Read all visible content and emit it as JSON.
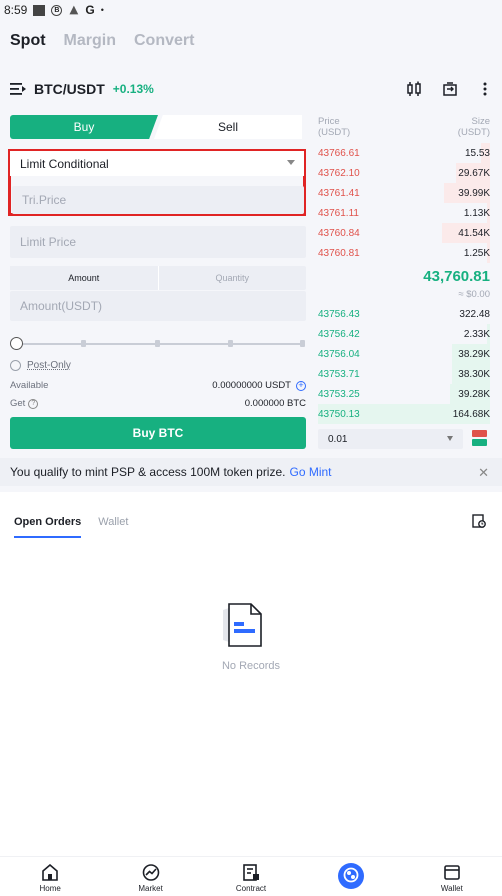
{
  "status_bar": {
    "time": "8:59"
  },
  "mode_tabs": [
    {
      "label": "Spot",
      "active": true
    },
    {
      "label": "Margin",
      "active": false
    },
    {
      "label": "Convert",
      "active": false
    }
  ],
  "pair": {
    "symbol": "BTC/USDT",
    "change": "+0.13%"
  },
  "order_form": {
    "buy_label": "Buy",
    "sell_label": "Sell",
    "order_type": "Limit Conditional",
    "trigger_price_placeholder": "Tri.Price",
    "limit_price_placeholder": "Limit Price",
    "amount_tab": "Amount",
    "quantity_tab": "Quantity",
    "amount_placeholder": "Amount(USDT)",
    "slider_percent": 0,
    "post_only_label": "Post-Only",
    "available_label": "Available",
    "available_value": "0.00000000 USDT",
    "get_label": "Get",
    "get_value": "0.000000 BTC",
    "submit_label": "Buy BTC"
  },
  "order_book": {
    "price_header": "Price",
    "price_unit": "(USDT)",
    "size_header": "Size",
    "size_unit": "(USDT)",
    "asks": [
      {
        "price": "43766.61",
        "size": "15.53",
        "depth": 0.05
      },
      {
        "price": "43762.10",
        "size": "29.67K",
        "depth": 0.2
      },
      {
        "price": "43761.41",
        "size": "39.99K",
        "depth": 0.27
      },
      {
        "price": "43761.11",
        "size": "1.13K",
        "depth": 0.02
      },
      {
        "price": "43760.84",
        "size": "41.54K",
        "depth": 0.28
      },
      {
        "price": "43760.81",
        "size": "1.25K",
        "depth": 0.02
      }
    ],
    "last_price": "43,760.81",
    "last_price_usd": "≈ $0.00",
    "bids": [
      {
        "price": "43756.43",
        "size": "322.48",
        "depth": 0.0
      },
      {
        "price": "43756.42",
        "size": "2.33K",
        "depth": 0.02
      },
      {
        "price": "43756.04",
        "size": "38.29K",
        "depth": 0.22
      },
      {
        "price": "43753.71",
        "size": "38.30K",
        "depth": 0.22
      },
      {
        "price": "43753.25",
        "size": "39.28K",
        "depth": 0.23
      },
      {
        "price": "43750.13",
        "size": "164.68K",
        "depth": 1.0
      }
    ],
    "depth_value": "0.01"
  },
  "promo": {
    "text": "You qualify to mint PSP & access 100M token prize.",
    "link": "Go Mint",
    "close": "✕"
  },
  "orders": {
    "tabs": [
      {
        "label": "Open Orders",
        "active": true
      },
      {
        "label": "Wallet",
        "active": false
      }
    ],
    "empty_text": "No Records"
  },
  "nav": [
    {
      "label": "Home",
      "icon": "home-icon"
    },
    {
      "label": "Market",
      "icon": "market-icon"
    },
    {
      "label": "Contract",
      "icon": "contract-icon"
    },
    {
      "label": "",
      "icon": "center-logo-icon"
    },
    {
      "label": "Wallet",
      "icon": "wallet-icon"
    }
  ],
  "colors": {
    "green": "#17b080",
    "red": "#e0524b",
    "blue": "#2f6bff",
    "highlight": "#e02424"
  }
}
